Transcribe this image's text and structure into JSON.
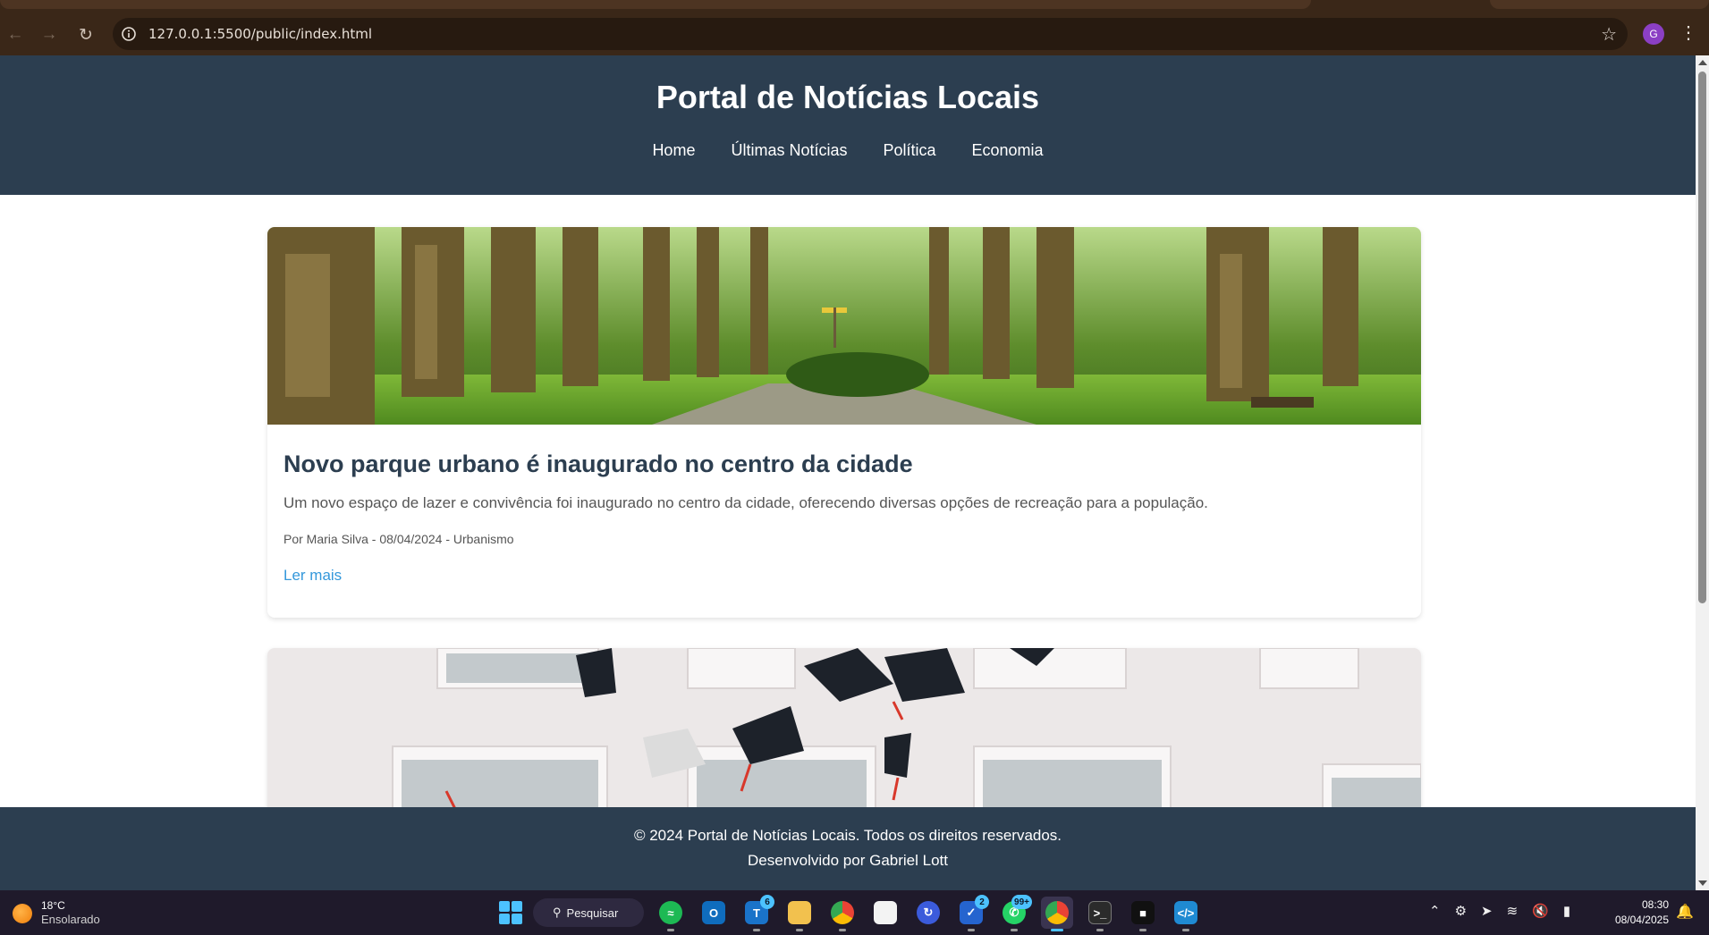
{
  "browser": {
    "url": "127.0.0.1:5500/public/index.html",
    "profile_initial": "G"
  },
  "header": {
    "title": "Portal de Notícias Locais",
    "nav": [
      {
        "label": "Home"
      },
      {
        "label": "Últimas Notícias"
      },
      {
        "label": "Política"
      },
      {
        "label": "Economia"
      }
    ]
  },
  "articles": [
    {
      "title": "Novo parque urbano é inaugurado no centro da cidade",
      "summary": "Um novo espaço de lazer e convivência foi inaugurado no centro da cidade, oferecendo diversas opções de recreação para a população.",
      "meta": "Por Maria Silva - 08/04/2024 - Urbanismo",
      "link": "Ler mais",
      "image": "park-trees-image"
    },
    {
      "image": "graduation-caps-image"
    }
  ],
  "footer": {
    "copyright": "© 2024 Portal de Notícias Locais. Todos os direitos reservados.",
    "credit": "Desenvolvido por Gabriel Lott"
  },
  "taskbar": {
    "weather_temp": "18°C",
    "weather_condition": "Ensolarado",
    "search_label": "Pesquisar",
    "badges": {
      "teams": "6",
      "todo": "2",
      "whatsapp": "99+"
    },
    "time": "08:30",
    "date": "08/04/2025"
  },
  "colors": {
    "header_bg": "#2c3e50",
    "link": "#3498db",
    "browser_frame": "#3a2718"
  }
}
